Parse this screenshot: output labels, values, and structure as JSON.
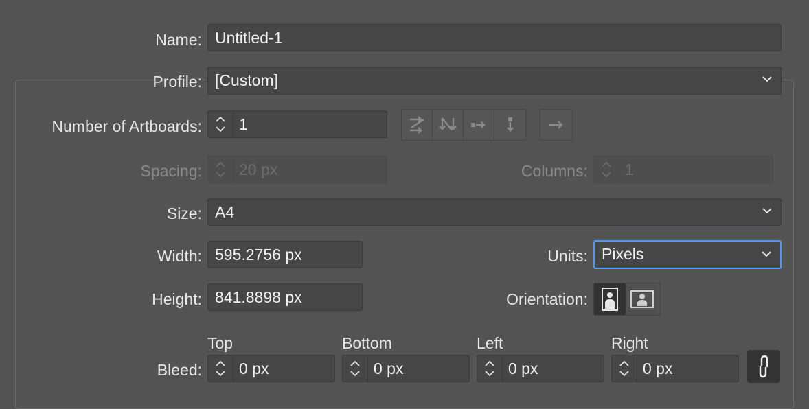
{
  "name": {
    "label": "Name:",
    "value": "Untitled-1"
  },
  "profile": {
    "label": "Profile:",
    "value": "[Custom]"
  },
  "artboards": {
    "label": "Number of Artboards:",
    "value": "1"
  },
  "spacing": {
    "label": "Spacing:",
    "value": "20 px"
  },
  "columns": {
    "label": "Columns:",
    "value": "1"
  },
  "size": {
    "label": "Size:",
    "value": "A4"
  },
  "width": {
    "label": "Width:",
    "value": "595.2756 px"
  },
  "units": {
    "label": "Units:",
    "value": "Pixels"
  },
  "height": {
    "label": "Height:",
    "value": "841.8898 px"
  },
  "orientation": {
    "label": "Orientation:"
  },
  "bleed": {
    "label": "Bleed:",
    "top": {
      "label": "Top",
      "value": "0 px"
    },
    "bottom": {
      "label": "Bottom",
      "value": "0 px"
    },
    "left": {
      "label": "Left",
      "value": "0 px"
    },
    "right": {
      "label": "Right",
      "value": "0 px"
    }
  },
  "colors": {
    "focus": "#4d9bea",
    "background": "#535353"
  }
}
